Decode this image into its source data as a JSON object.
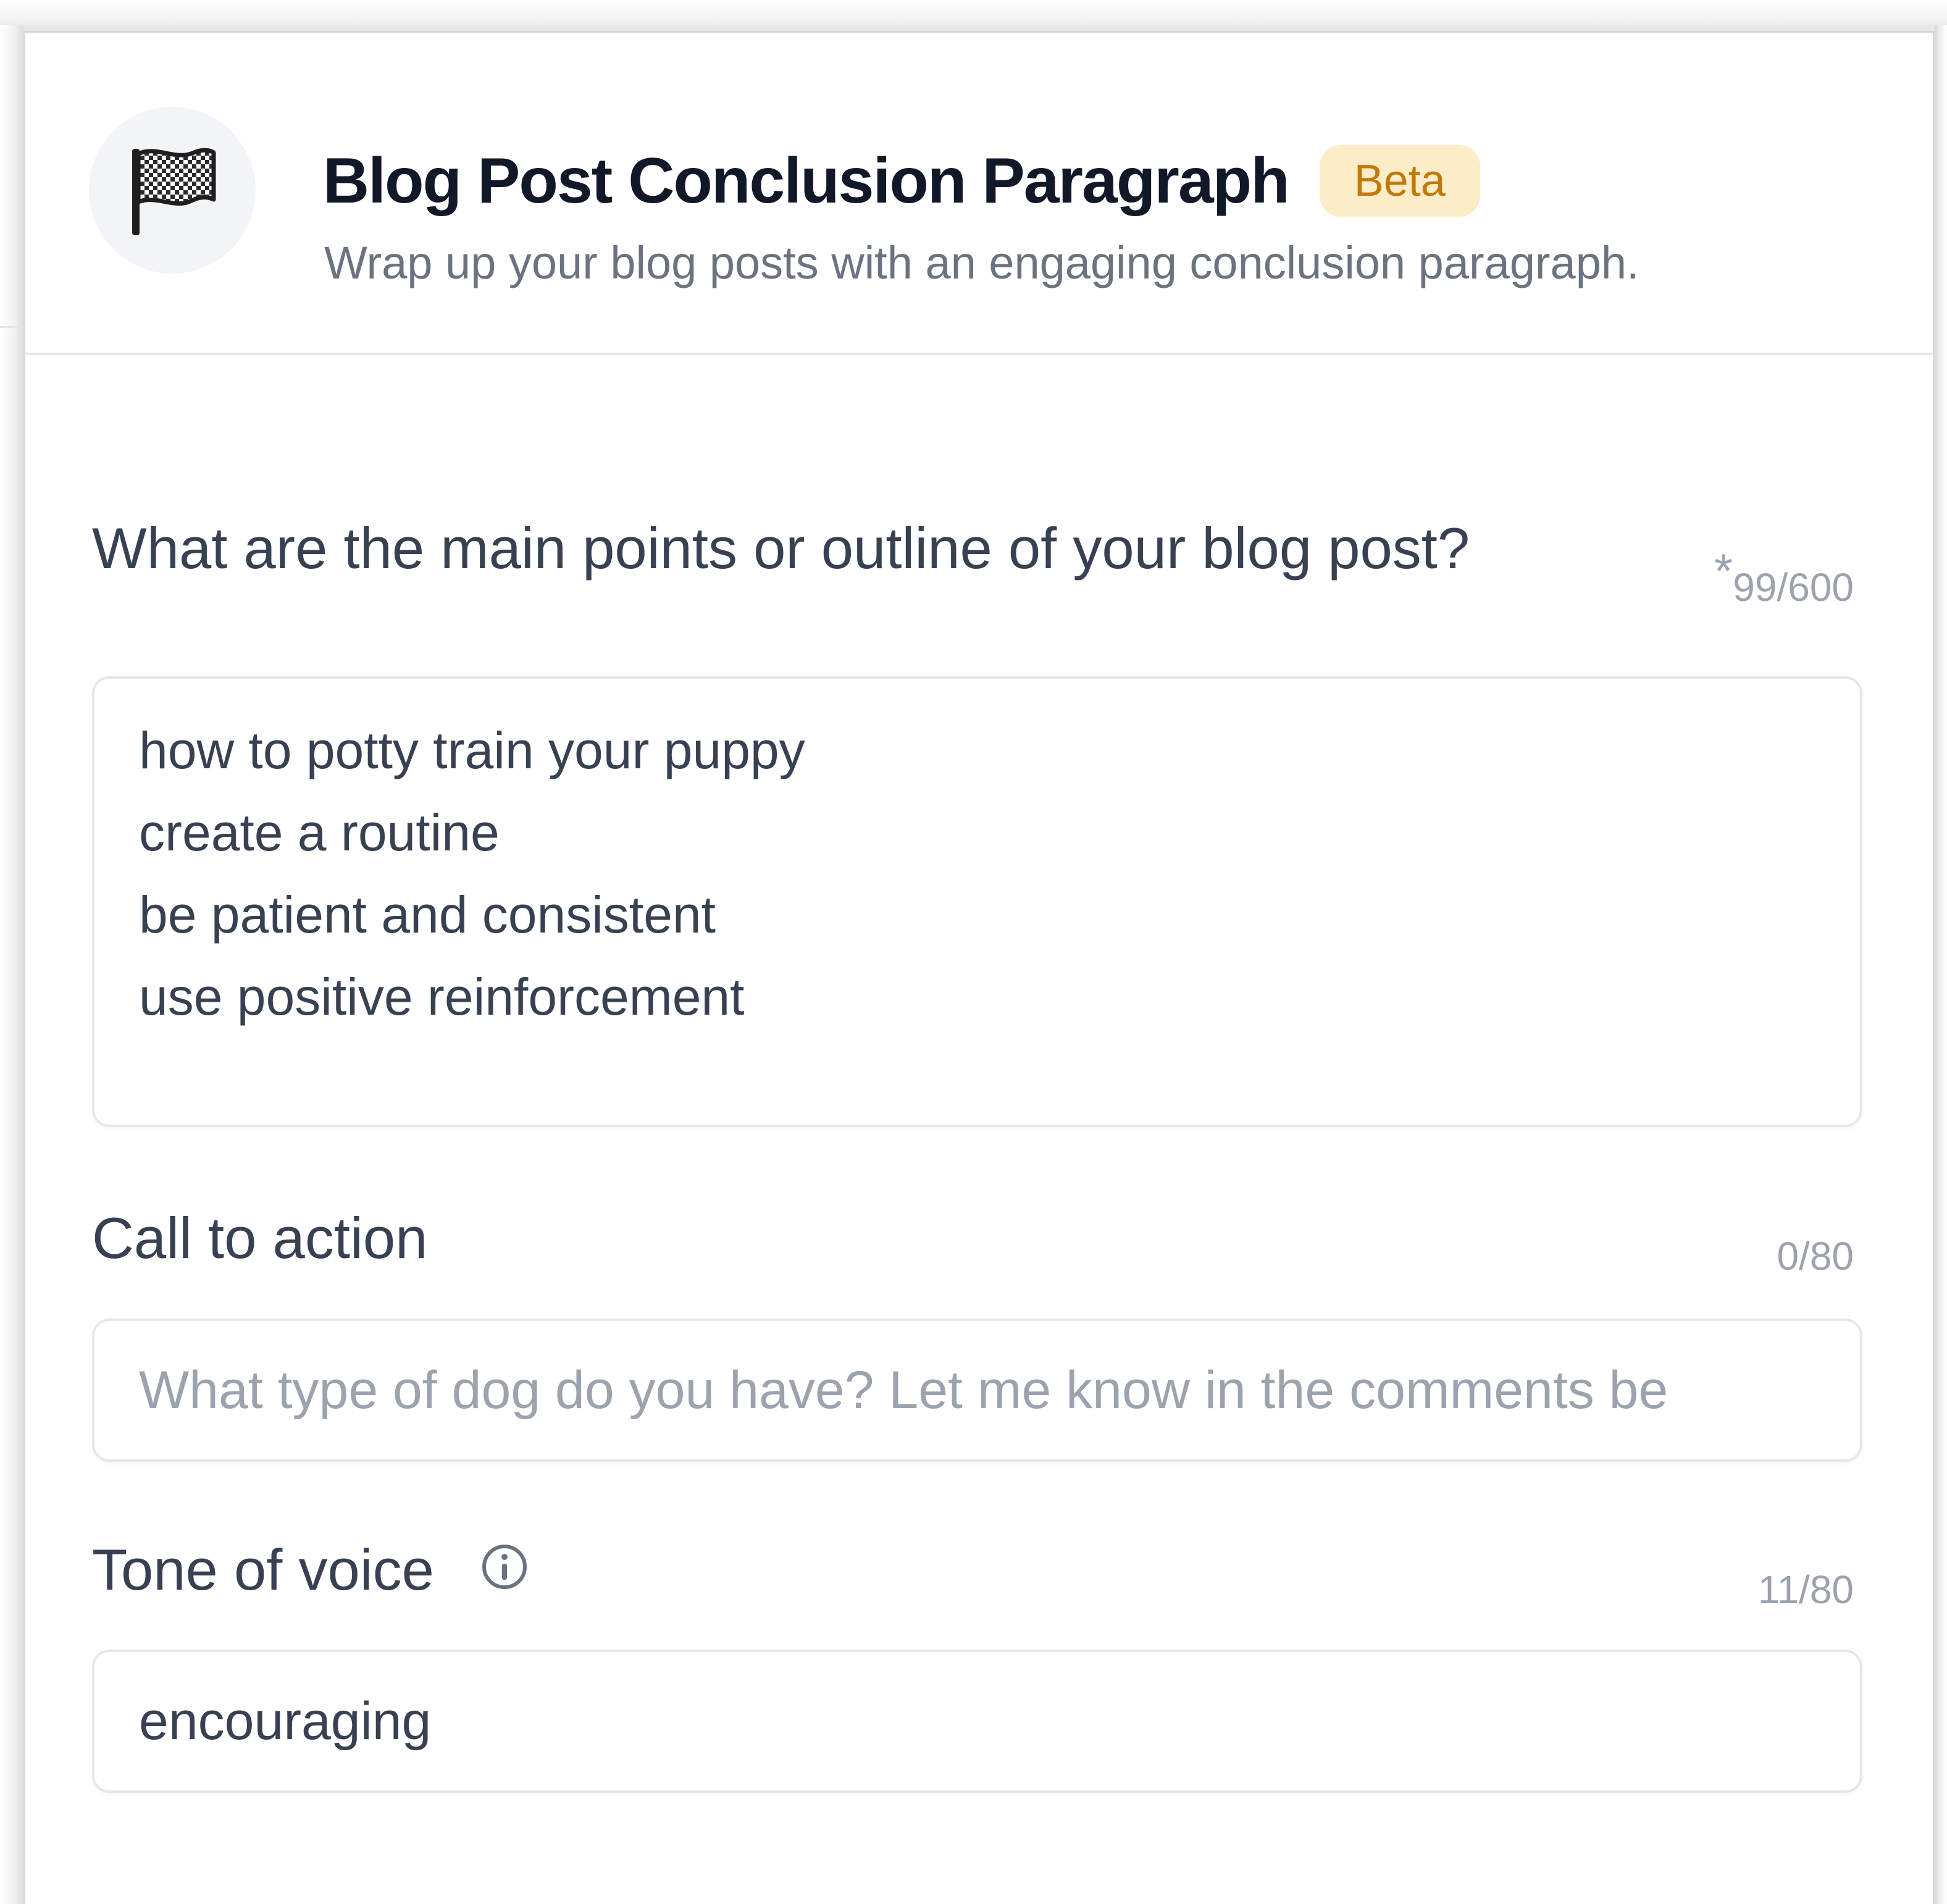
{
  "header": {
    "icon": "checkered-flag-icon",
    "title": "Blog Post Conclusion Paragraph",
    "badge": "Beta",
    "subtitle": "Wrap up your blog posts with an engaging conclusion paragraph."
  },
  "fields": {
    "main_points": {
      "label": "What are the main points or outline of your blog post?",
      "required_marker": "*",
      "counter": "99/600",
      "lines": [
        "how to potty train your puppy",
        "create a routine",
        "be patient and consistent",
        "use positive reinforcement"
      ]
    },
    "call_to_action": {
      "label": "Call to action",
      "counter": "0/80",
      "placeholder": "What type of dog do you have? Let me know in the comments be",
      "value": ""
    },
    "tone_of_voice": {
      "label": "Tone of voice",
      "info_icon": "info-icon",
      "counter": "11/80",
      "value": "encouraging"
    }
  },
  "colors": {
    "title": "#111827",
    "subtitle": "#6b7280",
    "badge_bg": "#fdecc8",
    "badge_text": "#c2780a",
    "border": "#e5e7eb",
    "placeholder": "#9ca3af"
  }
}
